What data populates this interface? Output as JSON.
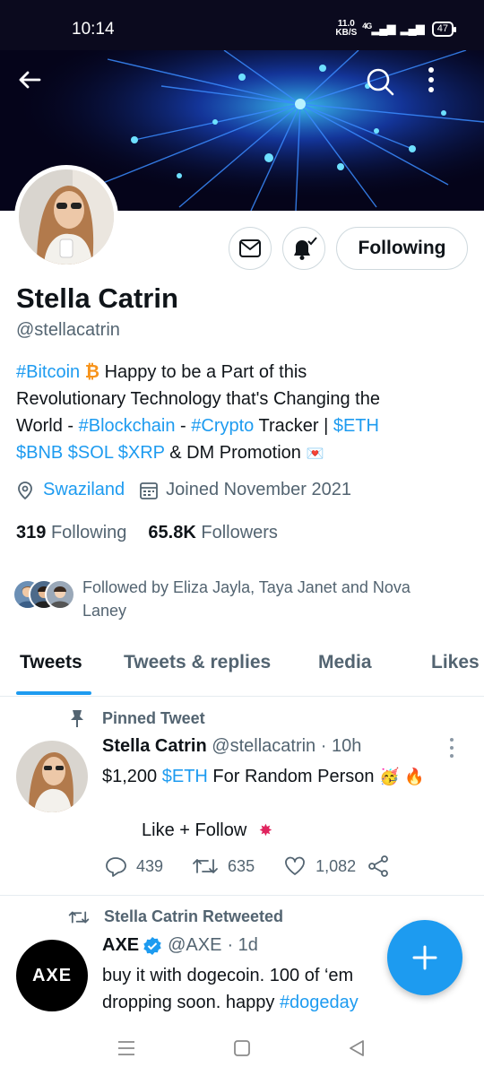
{
  "status_bar": {
    "time": "10:14",
    "net_speed_value": "11.0",
    "net_speed_unit": "KB/S",
    "network": "4G",
    "battery": "47"
  },
  "profile": {
    "display_name": "Stella Catrin",
    "handle": "@stellacatrin",
    "following_button": "Following",
    "bio": {
      "line1_tag": "#Bitcoin",
      "line1_rest": " Happy to be a Part of this",
      "line2": "Revolutionary Technology that's Changing the",
      "line3_start": "World - ",
      "line3_tag1": "#Blockchain",
      "line3_mid": " - ",
      "line3_tag2": "#Crypto",
      "line3_rest": "  Tracker | ",
      "line3_tag3": "$ETH",
      "line4_tags": "$BNB $SOL $XRP",
      "line4_rest": " & DM Promotion"
    },
    "location": "Swaziland",
    "joined": "Joined November 2021",
    "following_count": "319",
    "following_label": "Following",
    "followers_count": "65.8K",
    "followers_label": "Followers",
    "followed_by": "Followed by Eliza Jayla, Taya Janet and Nova Laney"
  },
  "tabs": [
    {
      "label": "Tweets",
      "active": true
    },
    {
      "label": "Tweets & replies",
      "active": false
    },
    {
      "label": "Media",
      "active": false
    },
    {
      "label": "Likes",
      "active": false
    }
  ],
  "pinned_tweet": {
    "pinned_label": "Pinned Tweet",
    "author_name": "Stella Catrin",
    "author_handle": "@stellacatrin",
    "time": "· 10h",
    "body_prefix": "$1,200 ",
    "body_tag": "$ETH",
    "body_rest": " For Random Person",
    "body_line2": "Like + Follow",
    "replies": "439",
    "retweets": "635",
    "likes": "1,082"
  },
  "retweet": {
    "label": "Stella Catrin Retweeted",
    "author_name": "AXE",
    "author_handle": "@AXE",
    "time": "· 1d",
    "avatar_text": "AXE",
    "body_line1": "buy it with dogecoin. 100 of ‘em",
    "body_line2_prefix": "dropping soon. happy ",
    "body_line2_tag": "#dogeday"
  },
  "colors": {
    "accent": "#1d9bf0",
    "text": "#0f1419",
    "secondary": "#536471"
  }
}
